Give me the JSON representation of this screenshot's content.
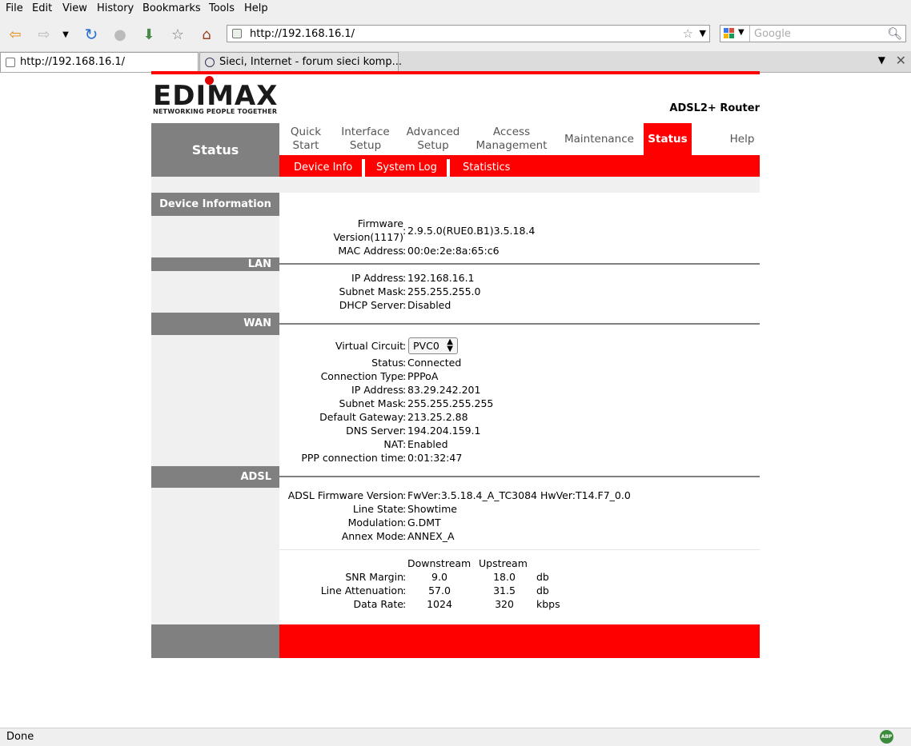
{
  "browser": {
    "menu": [
      "File",
      "Edit",
      "View",
      "History",
      "Bookmarks",
      "Tools",
      "Help"
    ],
    "url": "http://192.168.16.1/",
    "search_placeholder": "Google",
    "tabs": [
      {
        "title": "http://192.168.16.1/"
      },
      {
        "title": "Sieci, Internet - forum sieci komp..."
      }
    ],
    "status_text": "Done",
    "addon_badge": "ABP"
  },
  "page": {
    "logo_text": "EDIMAX",
    "logo_tagline": "NETWORKING PEOPLE TOGETHER",
    "product": "ADSL2+ Router",
    "section_title": "Status",
    "nav": [
      {
        "label": "Quick Start"
      },
      {
        "label": "Interface Setup"
      },
      {
        "label": "Advanced Setup"
      },
      {
        "label": "Access Management"
      },
      {
        "label": "Maintenance"
      },
      {
        "label": "Status"
      },
      {
        "label": "Help"
      }
    ],
    "subnav": [
      "Device Info",
      "System Log",
      "Statistics"
    ],
    "device_info": {
      "heading": "Device Information",
      "firmware_label": "Firmware Version(1117)",
      "firmware_value": "2.9.5.0(RUE0.B1)3.5.18.4",
      "mac_label": "MAC Address",
      "mac_value": "00:0e:2e:8a:65:c6"
    },
    "lan": {
      "heading": "LAN",
      "ip_label": "IP Address",
      "ip_value": "192.168.16.1",
      "mask_label": "Subnet Mask",
      "mask_value": "255.255.255.0",
      "dhcp_label": "DHCP Server",
      "dhcp_value": "Disabled"
    },
    "wan": {
      "heading": "WAN",
      "vc_label": "Virtual Circuit",
      "vc_value": "PVC0",
      "status_label": "Status",
      "status_value": "Connected",
      "conn_label": "Connection Type",
      "conn_value": "PPPoA",
      "ip_label": "IP Address",
      "ip_value": "83.29.242.201",
      "mask_label": "Subnet Mask",
      "mask_value": "255.255.255.255",
      "gw_label": "Default Gateway",
      "gw_value": "213.25.2.88",
      "dns_label": "DNS Server",
      "dns_value": "194.204.159.1",
      "nat_label": "NAT",
      "nat_value": "Enabled",
      "ppp_label": "PPP connection time",
      "ppp_value": "0:01:32:47"
    },
    "adsl": {
      "heading": "ADSL",
      "fw_label": "ADSL Firmware Version",
      "fw_value": "FwVer:3.5.18.4_A_TC3084 HwVer:T14.F7_0.0",
      "line_label": "Line State",
      "line_value": "Showtime",
      "mod_label": "Modulation",
      "mod_value": "G.DMT",
      "annex_label": "Annex Mode",
      "annex_value": "ANNEX_A",
      "col_down": "Downstream",
      "col_up": "Upstream",
      "rows": [
        {
          "label": "SNR Margin",
          "down": "9.0",
          "up": "18.0",
          "unit": "db"
        },
        {
          "label": "Line Attenuation",
          "down": "57.0",
          "up": "31.5",
          "unit": "db"
        },
        {
          "label": "Data Rate",
          "down": "1024",
          "up": "320",
          "unit": "kbps"
        }
      ]
    }
  }
}
